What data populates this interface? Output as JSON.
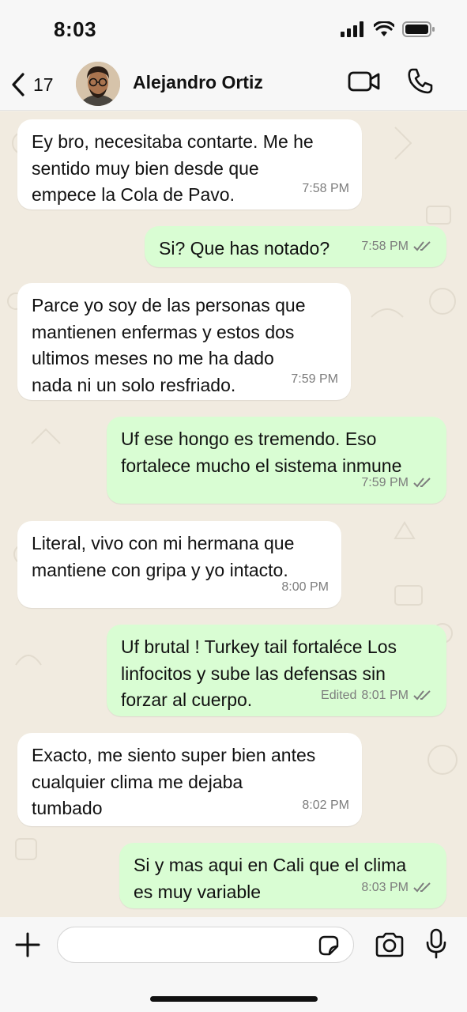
{
  "status_bar": {
    "time": "8:03"
  },
  "header": {
    "back_count": "17",
    "contact_name": "Alejandro Ortiz"
  },
  "messages": [
    {
      "direction": "incoming",
      "text": "Ey bro, necesitaba contarte. Me he\nsentido muy bien desde que\nempece la Cola de Pavo.",
      "time": "7:58 PM"
    },
    {
      "direction": "outgoing",
      "text": "Si? Que has notado?",
      "time": "7:58 PM",
      "read": true
    },
    {
      "direction": "incoming",
      "text": "Parce yo soy de las personas que\nmantienen enfermas y estos dos\nultimos meses no me ha dado\nnada ni un solo resfriado.",
      "time": "7:59 PM"
    },
    {
      "direction": "outgoing",
      "text": "Uf ese hongo es tremendo. Eso\nfortalece mucho el sistema inmune",
      "time": "7:59 PM",
      "read": true
    },
    {
      "direction": "incoming",
      "text": "Literal, vivo con mi hermana que\nmantiene con gripa y yo intacto.",
      "time": "8:00 PM"
    },
    {
      "direction": "outgoing",
      "text": "Uf brutal ! Turkey tail fortaléce Los\nlinfocitos  y sube las defensas sin\nforzar al cuerpo.",
      "time": "8:01 PM",
      "edited": "Edited",
      "read": true
    },
    {
      "direction": "incoming",
      "text": "Exacto, me siento super bien antes\ncualquier clima me dejaba\ntumbado",
      "time": "8:02 PM"
    },
    {
      "direction": "outgoing",
      "text": "Si y mas aqui en Cali que el clima\nes muy variable",
      "time": "8:03 PM",
      "read": true
    }
  ],
  "input": {
    "placeholder": ""
  },
  "icons": {
    "back": "chevron-left-icon",
    "video": "video-camera-icon",
    "call": "phone-icon",
    "plus": "plus-icon",
    "sticker": "sticker-icon",
    "camera": "camera-icon",
    "mic": "microphone-icon"
  },
  "colors": {
    "outgoing_bubble": "#d9fdd3",
    "incoming_bubble": "#ffffff",
    "read_ticks": "#7d7d7d",
    "wallpaper": "#f1ebe0"
  }
}
